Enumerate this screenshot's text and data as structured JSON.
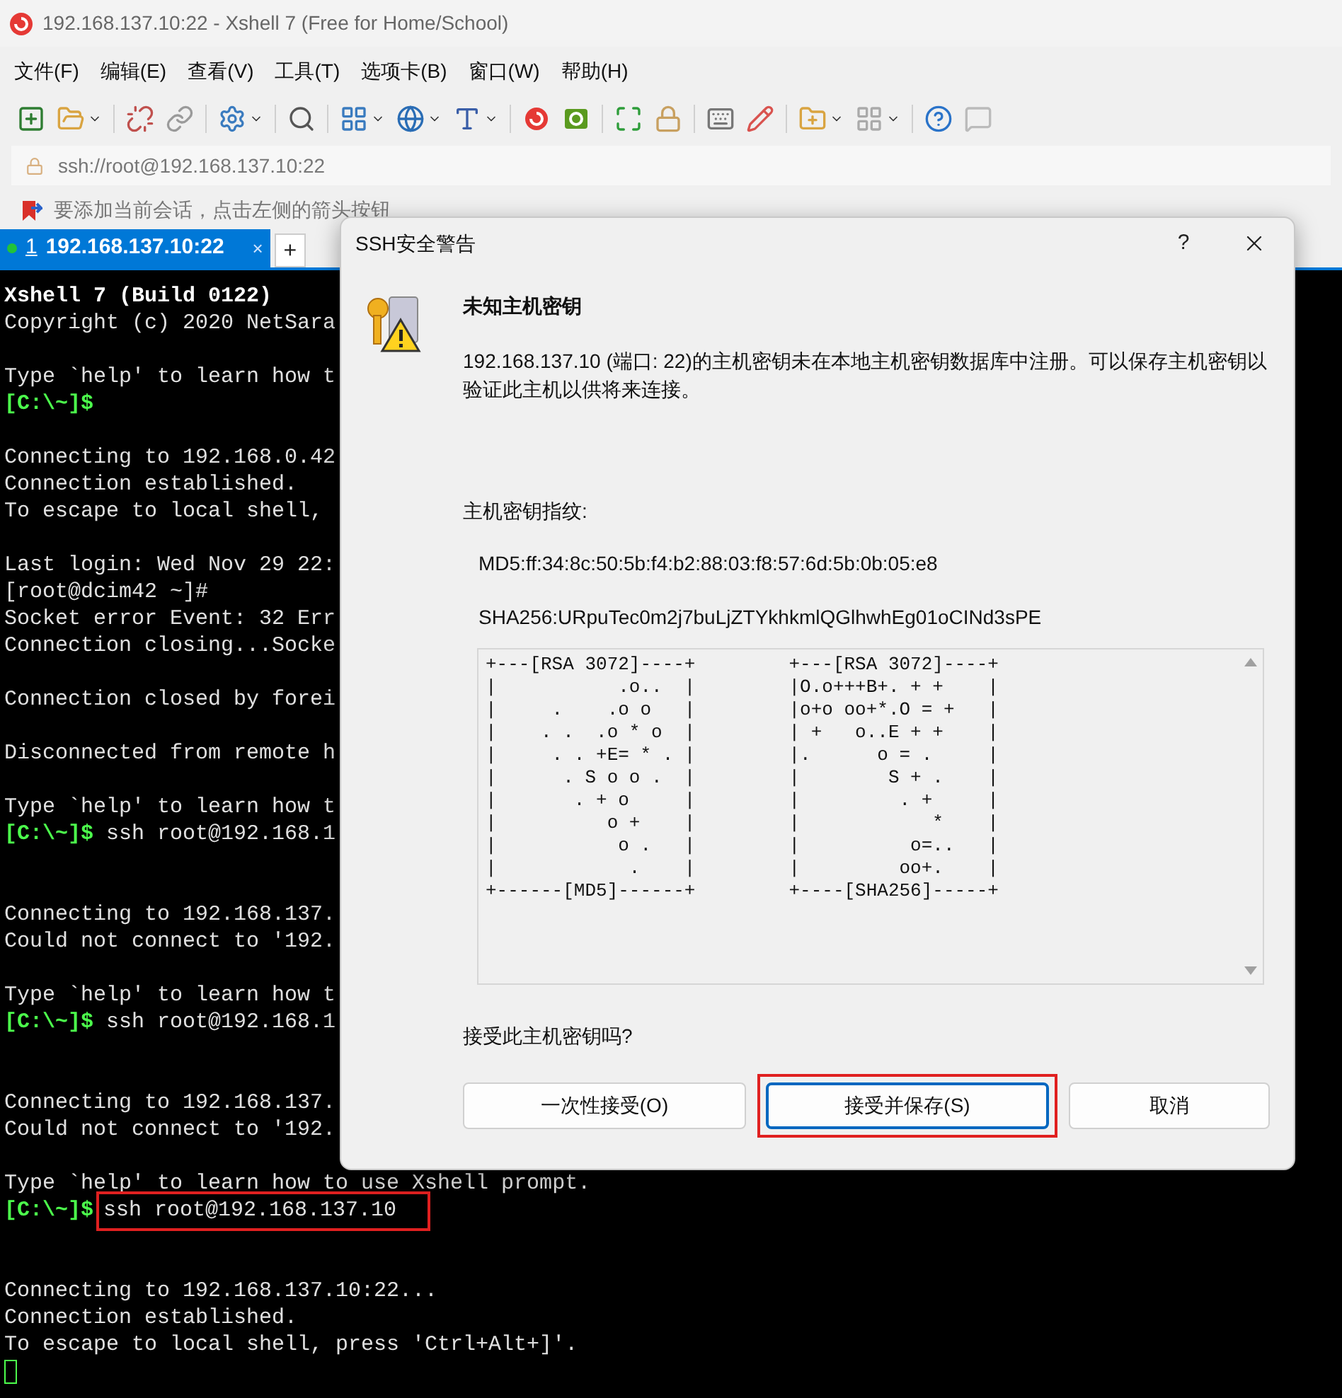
{
  "window": {
    "title": "192.168.137.10:22 - Xshell 7 (Free for Home/School)"
  },
  "menu": [
    "文件(F)",
    "编辑(E)",
    "查看(V)",
    "工具(T)",
    "选项卡(B)",
    "窗口(W)",
    "帮助(H)"
  ],
  "address_bar": {
    "value": "ssh://root@192.168.137.10:22"
  },
  "info_bar": {
    "text": "要添加当前会话，点击左侧的箭头按钮"
  },
  "tabs": [
    {
      "number": "1",
      "label": "192.168.137.10:22",
      "selected": true,
      "connected": true,
      "close": "×"
    }
  ],
  "new_tab": "+",
  "terminal": {
    "lines": [
      {
        "kind": "bold",
        "text": "Xshell 7 (Build 0122)"
      },
      {
        "kind": "plain",
        "text": "Copyright (c) 2020 NetSara"
      },
      {
        "kind": "blank"
      },
      {
        "kind": "plain",
        "text": "Type `help' to learn how t"
      },
      {
        "kind": "prompt",
        "prompt": "[C:\\~]$"
      },
      {
        "kind": "blank"
      },
      {
        "kind": "plain",
        "text": "Connecting to 192.168.0.42"
      },
      {
        "kind": "plain",
        "text": "Connection established."
      },
      {
        "kind": "plain",
        "text": "To escape to local shell,"
      },
      {
        "kind": "blank"
      },
      {
        "kind": "plain",
        "text": "Last login: Wed Nov 29 22:"
      },
      {
        "kind": "plain",
        "text": "[root@dcim42 ~]#"
      },
      {
        "kind": "plain",
        "text": "Socket error Event: 32 Err"
      },
      {
        "kind": "plain",
        "text": "Connection closing...Socke"
      },
      {
        "kind": "blank"
      },
      {
        "kind": "plain",
        "text": "Connection closed by forei"
      },
      {
        "kind": "blank"
      },
      {
        "kind": "plain",
        "text": "Disconnected from remote h"
      },
      {
        "kind": "blank"
      },
      {
        "kind": "plain",
        "text": "Type `help' to learn how t"
      },
      {
        "kind": "prompt",
        "prompt": "[C:\\~]$",
        "command": "ssh root@192.168.1"
      },
      {
        "kind": "blank"
      },
      {
        "kind": "blank"
      },
      {
        "kind": "plain",
        "text": "Connecting to 192.168.137."
      },
      {
        "kind": "plain",
        "text": "Could not connect to '192."
      },
      {
        "kind": "blank"
      },
      {
        "kind": "plain",
        "text": "Type `help' to learn how t"
      },
      {
        "kind": "prompt",
        "prompt": "[C:\\~]$",
        "command": "ssh root@192.168.1"
      },
      {
        "kind": "blank"
      },
      {
        "kind": "blank"
      },
      {
        "kind": "plain",
        "text": "Connecting to 192.168.137."
      },
      {
        "kind": "plain",
        "text": "Could not connect to '192."
      },
      {
        "kind": "blank"
      },
      {
        "kind": "plain",
        "text": "Type `help' to learn how to use Xshell prompt."
      },
      {
        "kind": "prompt",
        "prompt": "[C:\\~]$",
        "command": "ssh root@192.168.137.10",
        "highlighted": true
      },
      {
        "kind": "blank"
      },
      {
        "kind": "blank"
      },
      {
        "kind": "plain",
        "text": "Connecting to 192.168.137.10:22..."
      },
      {
        "kind": "plain",
        "text": "Connection established."
      },
      {
        "kind": "plain",
        "text": "To escape to local shell, press 'Ctrl+Alt+]'."
      },
      {
        "kind": "cursor"
      }
    ]
  },
  "dialog": {
    "title": "SSH安全警告",
    "help": "?",
    "heading": "未知主机密钥",
    "message": "192.168.137.10 (端口: 22)的主机密钥未在本地主机密钥数据库中注册。可以保存主机密钥以验证此主机以供将来连接。",
    "fingerprint_label": "主机密钥指纹:",
    "fingerprints": [
      "MD5:ff:34:8c:50:5b:f4:b2:88:03:f8:57:6d:5b:0b:05:e8",
      "SHA256:URpuTec0m2j7buLjZTYkhkmlQGlhwhEg01oCINd3sPE"
    ],
    "randomart": [
      [
        "+---[RSA 3072]----+",
        "|           .o..  |",
        "|     .    .o o   |",
        "|    . .  .o * o  |",
        "|     . . +E= * . |",
        "|      . S o o .  |",
        "|       . + o     |",
        "|          o +    |",
        "|           o .   |",
        "|            .    |",
        "+------[MD5]------+"
      ],
      [
        "+---[RSA 3072]----+",
        "|O.o+++B+. + +    |",
        "|o+o oo+*.O = +   |",
        "| +   o..E + +    |",
        "|.      o = .     |",
        "|        S + .    |",
        "|         . +     |",
        "|            *    |",
        "|          o=..   |",
        "|         oo+.    |",
        "+----[SHA256]-----+"
      ]
    ],
    "question": "接受此主机密钥吗?",
    "buttons": [
      {
        "label": "一次性接受(O)",
        "default": false,
        "highlighted": false
      },
      {
        "label": "接受并保存(S)",
        "default": true,
        "highlighted": true
      },
      {
        "label": "取消",
        "default": false,
        "highlighted": false
      }
    ]
  }
}
